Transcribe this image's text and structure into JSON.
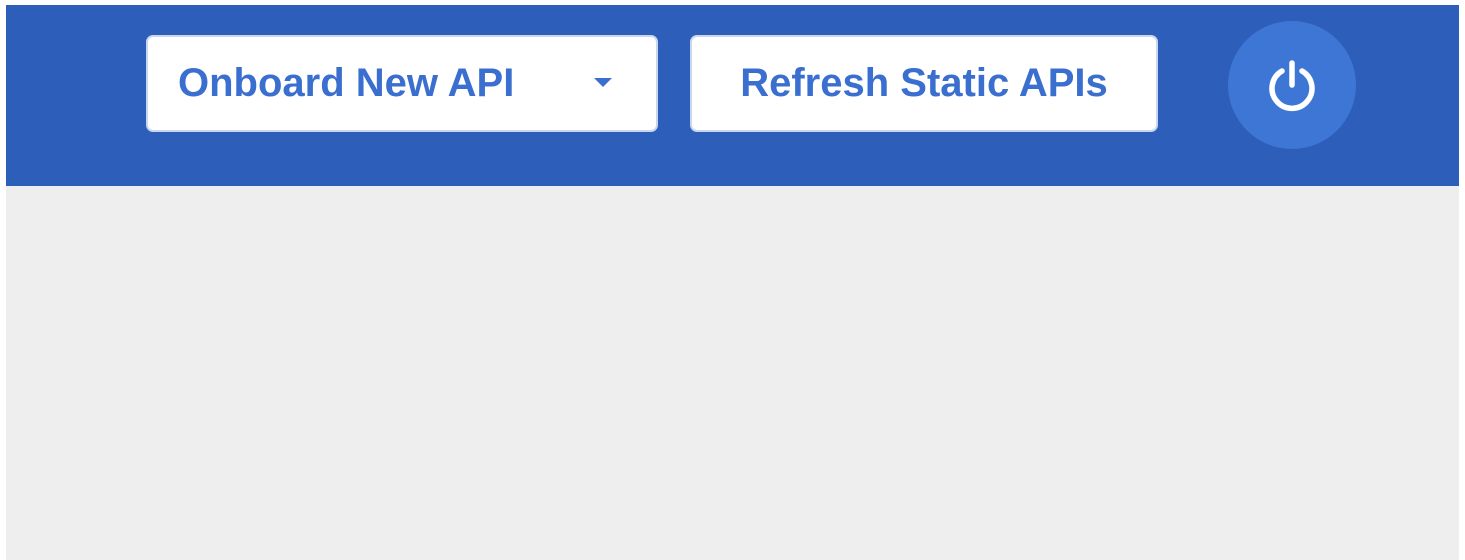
{
  "header": {
    "onboard_button": {
      "label": "Onboard New API",
      "icon": "caret-down-icon"
    },
    "refresh_button": {
      "label": "Refresh Static APIs"
    },
    "power_button": {
      "icon": "power-icon"
    }
  },
  "colors": {
    "header_bg": "#2d5eba",
    "button_text": "#3a6fcf",
    "power_bg": "#3e76d6",
    "content_bg": "#eeeeee"
  }
}
